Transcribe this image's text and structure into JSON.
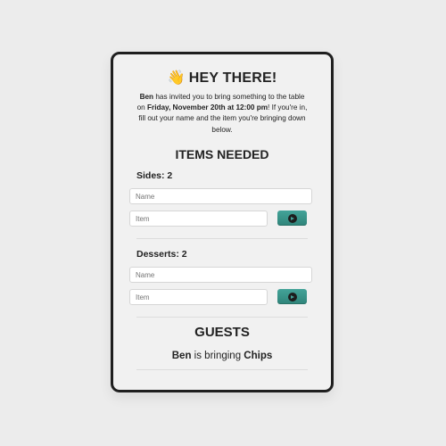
{
  "header": {
    "wave_emoji": "👋",
    "title": "HEY THERE!"
  },
  "intro": {
    "host": "Ben",
    "text_1": " has invited you to bring something to the table on ",
    "date": "Friday, November 20th at 12:00 pm",
    "text_2": "! If you're in, fill out your name and the item you're bringing down below."
  },
  "items_heading": "ITEMS NEEDED",
  "categories": [
    {
      "label": "Sides: 2",
      "name_placeholder": "Name",
      "item_placeholder": "Item"
    },
    {
      "label": "Desserts: 2",
      "name_placeholder": "Name",
      "item_placeholder": "Item"
    }
  ],
  "add_icon": "arrow-right-circle-icon",
  "guests_heading": "GUESTS",
  "guests": [
    {
      "name": "Ben",
      "connector": " is bringing ",
      "item": "Chips"
    }
  ],
  "colors": {
    "accent": "#3a968b",
    "border": "#1f1f1f",
    "background": "#ececec",
    "card": "#f1f1f1"
  }
}
